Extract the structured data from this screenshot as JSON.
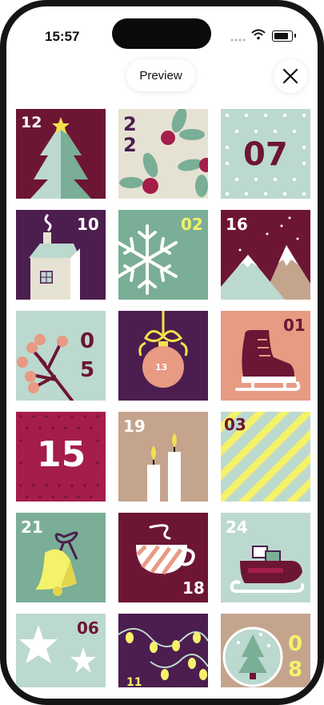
{
  "status": {
    "time": "15:57"
  },
  "header": {
    "preview_label": "Preview"
  },
  "tiles": [
    {
      "day": "12"
    },
    {
      "day": "22"
    },
    {
      "day": "07"
    },
    {
      "day": "10"
    },
    {
      "day": "02"
    },
    {
      "day": "16"
    },
    {
      "day": "05"
    },
    {
      "day": "13"
    },
    {
      "day": "01"
    },
    {
      "day": "15"
    },
    {
      "day": "19"
    },
    {
      "day": "03"
    },
    {
      "day": "21"
    },
    {
      "day": "18"
    },
    {
      "day": "24"
    },
    {
      "day": "06"
    },
    {
      "day": "11"
    },
    {
      "day": "08"
    }
  ],
  "colors": {
    "burgundy": "#6d1534",
    "purple": "#4c1d4f",
    "mint": "#bcd9cf",
    "sage": "#7aae96",
    "crimson": "#a51d4a",
    "tan": "#c4a48c",
    "peach": "#e89a83",
    "yellow": "#f4f26b",
    "cream": "#e6e2d3"
  }
}
